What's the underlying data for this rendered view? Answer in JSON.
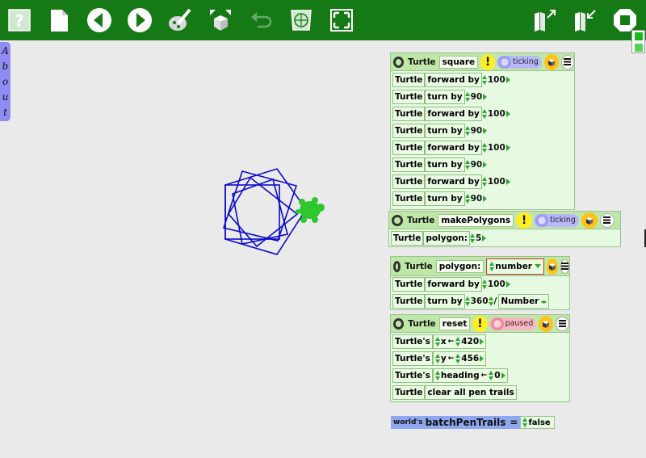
{
  "about_tab": {
    "letters": [
      "A",
      "b",
      "o",
      "u",
      "t"
    ]
  },
  "toolbar": {
    "icons": [
      "help-icon",
      "new-page-icon",
      "back-icon",
      "forward-icon",
      "paint-icon",
      "expand-box-icon",
      "undo-icon",
      "publish-icon",
      "fullscreen-icon",
      "expand-book-icon",
      "collapse-book-icon",
      "stop-icon"
    ],
    "help_label": "?"
  },
  "colors": {
    "toolbar": "#157a15",
    "canvas": "#eaeaea",
    "pen": "#0a0acc",
    "turtle": "#2ec72e",
    "script_bg": "#e6fae2",
    "script_header": "#bfe8a8"
  },
  "scripts": {
    "square": {
      "header": {
        "owner": "Turtle",
        "name": "square",
        "status": "ticking"
      },
      "rows": [
        {
          "who": "Turtle",
          "cmd": "forward by",
          "arg": "100"
        },
        {
          "who": "Turtle",
          "cmd": "turn by",
          "arg": "90"
        },
        {
          "who": "Turtle",
          "cmd": "forward by",
          "arg": "100"
        },
        {
          "who": "Turtle",
          "cmd": "turn by",
          "arg": "90"
        },
        {
          "who": "Turtle",
          "cmd": "forward by",
          "arg": "100"
        },
        {
          "who": "Turtle",
          "cmd": "turn by",
          "arg": "90"
        },
        {
          "who": "Turtle",
          "cmd": "forward by",
          "arg": "100"
        },
        {
          "who": "Turtle",
          "cmd": "turn by",
          "arg": "90"
        }
      ]
    },
    "makePolygons": {
      "header": {
        "owner": "Turtle",
        "name": "makePolygons",
        "status": "ticking"
      },
      "rows": [
        {
          "who": "Turtle",
          "cmd": "polygon:",
          "arg": "5"
        }
      ]
    },
    "polygon": {
      "header": {
        "owner": "Turtle",
        "name": "polygon:",
        "param": "number"
      },
      "rows": [
        {
          "who": "Turtle",
          "cmd": "forward by",
          "arg": "100"
        },
        {
          "who": "Turtle",
          "cmd": "turn by",
          "arg": "360",
          "op": "/",
          "arg2": "Number"
        }
      ]
    },
    "reset": {
      "header": {
        "owner": "Turtle",
        "name": "reset",
        "status": "paused"
      },
      "rows": [
        {
          "who": "Turtle's",
          "var": "x",
          "arrow": "←",
          "arg": "420"
        },
        {
          "who": "Turtle's",
          "var": "y",
          "arrow": "←",
          "arg": "456"
        },
        {
          "who": "Turtle's",
          "var": "heading",
          "arrow": "←",
          "arg": "0"
        },
        {
          "who": "Turtle",
          "cmd": "clear all pen trails"
        }
      ]
    }
  },
  "world_var": {
    "owner": "world's",
    "name": "batchPenTrails",
    "op": "=",
    "value": "false"
  },
  "warn_label": "!"
}
